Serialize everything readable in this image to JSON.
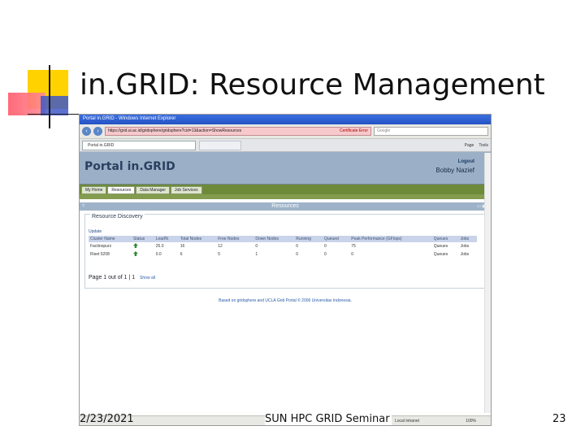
{
  "slide": {
    "title": "in.GRID: Resource Management",
    "date": "2/23/2021",
    "footer": "SUN HPC GRID Seminar",
    "page": "23"
  },
  "browser": {
    "window_title": "Portal in.GRID - Windows Internet Explorer",
    "url": "https://grid.ui.ac.id/gridsphere/gridsphere?cid=13&action=ShowResources",
    "cert_label": "Certificate Error",
    "search_placeholder": "Google",
    "tab_label": "Portal in.GRID",
    "tools": [
      "Page",
      "Tools"
    ],
    "status_zone": "Local intranet",
    "zoom": "100%"
  },
  "portal": {
    "title": "Portal in.GRID",
    "logout": "Logout",
    "user": "Bobby Nazief",
    "tabs": [
      "My Home",
      "Resources",
      "Data Manager",
      "Job Services"
    ],
    "active_tab": "Resources",
    "section_title": "Resources",
    "panel_title": "Resource Discovery",
    "update_link": "Update",
    "columns": [
      "Cluster Name",
      "Status",
      "Load%",
      "Total Nodes",
      "Free Nodes",
      "Down Nodes",
      "Running",
      "Queued",
      "Peak Performance (GFlops)",
      "Queues",
      "Jobs"
    ],
    "rows": [
      {
        "name": "Factinopurz",
        "load": "25.0",
        "total": "16",
        "free": "12",
        "down": "0",
        "running": "0",
        "queued": "0",
        "peak": "75",
        "queues": "Queues",
        "jobs": "Jobs"
      },
      {
        "name": "Riset 5208",
        "load": "0.0",
        "total": "6",
        "free": "5",
        "down": "1",
        "running": "0",
        "queued": "0",
        "peak": "0",
        "queues": "Queues",
        "jobs": "Jobs"
      }
    ],
    "pager": "Page 1 out of 1 | 1",
    "show_all": "Show all",
    "footer_note": "Based on gridsphere and UCLA Grid Portal © 2006 Universitas Indonesia."
  }
}
